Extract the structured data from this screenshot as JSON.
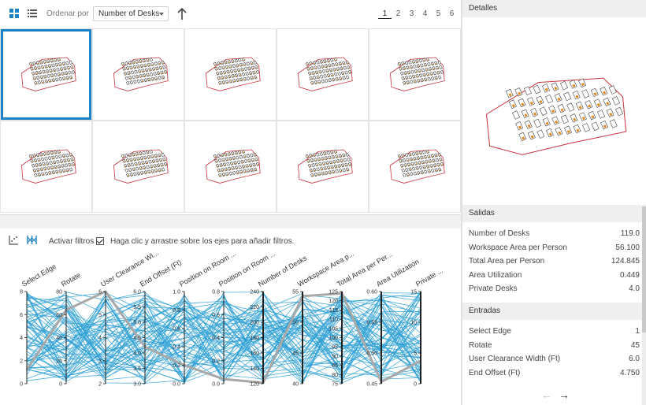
{
  "toolbar": {
    "sort_label": "Ordenar por",
    "sort_value": "Number of Desks",
    "pages": [
      "1",
      "2",
      "3",
      "4",
      "5",
      "6"
    ],
    "active_page": "1"
  },
  "filters": {
    "activate_label": "Activar filtros",
    "hint": "Haga clic y arrastre sobre los ejes para añadir filtros."
  },
  "parallel_axes": [
    {
      "label": "Select Edge",
      "ticks": [
        "8",
        "6",
        "4",
        "2",
        "0"
      ]
    },
    {
      "label": "Rotate",
      "ticks": [
        "80",
        "60",
        "40",
        "20",
        "0"
      ]
    },
    {
      "label": "User Clearance Wi...",
      "ticks": [
        "6",
        "5",
        "4",
        "3",
        "2"
      ]
    },
    {
      "label": "End Offset (Ft)",
      "ticks": [
        "6.0",
        "5.5",
        "5.0",
        "4.5",
        "4.0",
        "3.5",
        "3.0"
      ]
    },
    {
      "label": "Position on Room ...",
      "ticks": [
        "1.0",
        "0.8",
        "0.6",
        "0.4",
        "0.2",
        "0.0"
      ]
    },
    {
      "label": "Position on Room ...",
      "ticks": [
        "0.8",
        "0.6",
        "0.4",
        "0.2",
        "0.0"
      ]
    },
    {
      "label": "Number of Desks",
      "ticks": [
        "240",
        "220",
        "200",
        "180",
        "160",
        "140",
        "120"
      ]
    },
    {
      "label": "Workspace Area p...",
      "ticks": [
        "55",
        "50",
        "45",
        "40"
      ]
    },
    {
      "label": "Total Area per Per...",
      "ticks": [
        "125",
        "120",
        "115",
        "110",
        "105",
        "100",
        "95",
        "90",
        "85",
        "80",
        "75"
      ]
    },
    {
      "label": "Area Utilization",
      "ticks": [
        "0.60",
        "0.55",
        "0.50",
        "0.45"
      ]
    },
    {
      "label": "Private ...",
      "ticks": [
        "15",
        "10",
        "5",
        "0"
      ]
    }
  ],
  "details": {
    "title": "Detalles",
    "outputs_title": "Salidas",
    "outputs": [
      {
        "k": "Number of Desks",
        "v": "119.0"
      },
      {
        "k": "Workspace Area per Person",
        "v": "56.100"
      },
      {
        "k": "Total Area per Person",
        "v": "124.845"
      },
      {
        "k": "Area Utilization",
        "v": "0.449"
      },
      {
        "k": "Private Desks",
        "v": "4.0"
      }
    ],
    "inputs_title": "Entradas",
    "inputs": [
      {
        "k": "Select Edge",
        "v": "1"
      },
      {
        "k": "Rotate",
        "v": "45"
      },
      {
        "k": "User Clearance Width (Ft)",
        "v": "6.0"
      },
      {
        "k": "End Offset (Ft)",
        "v": "4.750"
      }
    ],
    "prev": "←",
    "next": "→"
  },
  "colors": {
    "accent": "#1a82c7",
    "line": "#2a9fd3",
    "outline": "#c8323c",
    "desk": "#e08a1e",
    "highlight": "#a8a8a8"
  }
}
